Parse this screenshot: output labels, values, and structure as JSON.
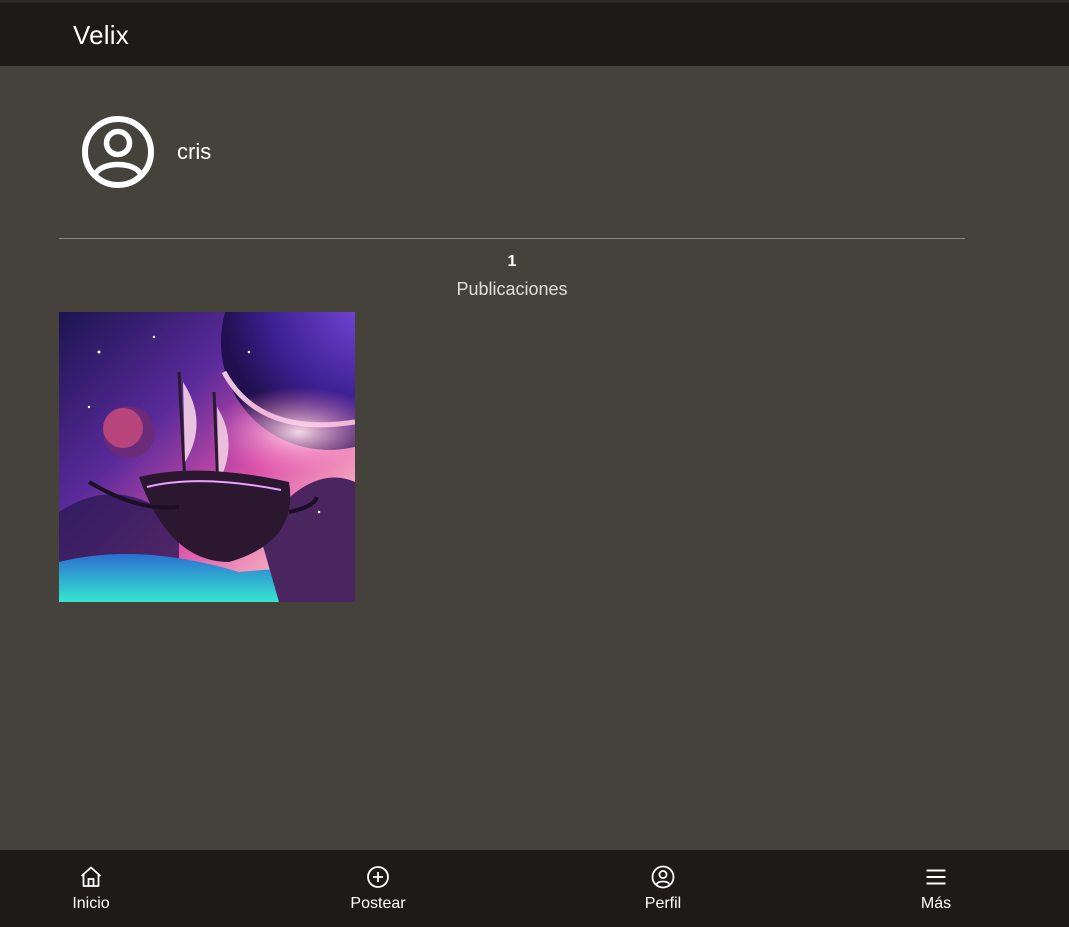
{
  "app": {
    "title": "Velix"
  },
  "profile": {
    "username": "cris",
    "avatar_icon": "user-circle-icon"
  },
  "stats": {
    "posts_count": "1",
    "posts_label": "Publicaciones"
  },
  "posts": [
    {
      "image_icon": "space-pirate-ship-image"
    }
  ],
  "bottom_nav": {
    "items": [
      {
        "label": "Inicio",
        "icon": "home-icon"
      },
      {
        "label": "Postear",
        "icon": "plus-circle-icon"
      },
      {
        "label": "Perfil",
        "icon": "user-circle-icon"
      },
      {
        "label": "Más",
        "icon": "menu-icon"
      }
    ]
  },
  "colors": {
    "background": "#45413b",
    "bars": "#1d1a17",
    "text": "#ffffff"
  }
}
